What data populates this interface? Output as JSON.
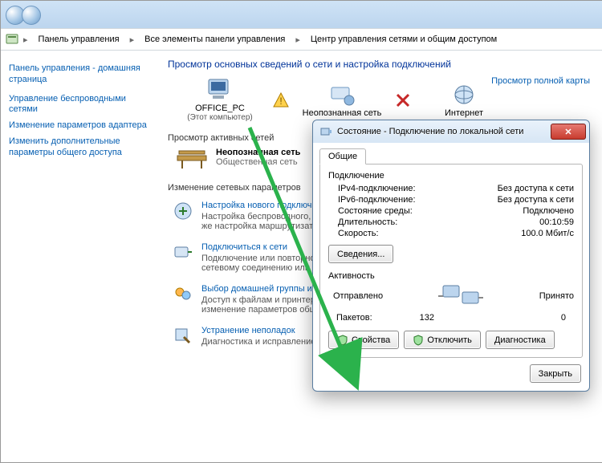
{
  "breadcrumb": {
    "seg1": "Панель управления",
    "seg2": "Все элементы панели управления",
    "seg3": "Центр управления сетями и общим доступом"
  },
  "sidebar": {
    "home": "Панель управления - домашняя страница",
    "items": [
      "Управление беспроводными сетями",
      "Изменение параметров адаптера",
      "Изменить дополнительные параметры общего доступа"
    ]
  },
  "main": {
    "title": "Просмотр основных сведений о сети и настройка подключений",
    "maplink": "Просмотр полной карты",
    "node1": "OFFICE_PC",
    "node1sub": "(Этот компьютер)",
    "node2": "Неопознанная сеть",
    "node3": "Интернет",
    "sec_active": "Просмотр активных сетей",
    "net_name": "Неопознанная сеть",
    "net_type": "Общественная сеть",
    "sec_params": "Изменение сетевых параметров",
    "items": [
      {
        "a": "Настройка нового подключения",
        "d": "Настройка беспроводного, широкополосного, модемного, прямого или VPN-подключения или же настройка маршрутизатора или точки доступа."
      },
      {
        "a": "Подключиться к сети",
        "d": "Подключение или повторное подключение к беспроводному, проводному, модемному сетевому соединению или подключение к VPN."
      },
      {
        "a": "Выбор домашней группы и параметров общего доступа",
        "d": "Доступ к файлам и принтерам, расположенным на других сетевых компьютерах, или изменение параметров общего доступа."
      },
      {
        "a": "Устранение неполадок",
        "d": "Диагностика и исправление сетевых проблем или получение сведений об исправлении."
      }
    ]
  },
  "dlg": {
    "title": "Состояние - Подключение по локальной сети",
    "tab": "Общие",
    "grp_conn": "Подключение",
    "kv": [
      {
        "k": "IPv4-подключение:",
        "v": "Без доступа к сети"
      },
      {
        "k": "IPv6-подключение:",
        "v": "Без доступа к сети"
      },
      {
        "k": "Состояние среды:",
        "v": "Подключено"
      },
      {
        "k": "Длительность:",
        "v": "00:10:59"
      },
      {
        "k": "Скорость:",
        "v": "100.0 Мбит/с"
      }
    ],
    "details": "Сведения...",
    "grp_act": "Активность",
    "sent": "Отправлено",
    "recv": "Принято",
    "pkts_lbl": "Пакетов:",
    "pkts_sent": "132",
    "pkts_recv": "0",
    "b_props": "Свойства",
    "b_disable": "Отключить",
    "b_diag": "Диагностика",
    "b_close": "Закрыть"
  }
}
